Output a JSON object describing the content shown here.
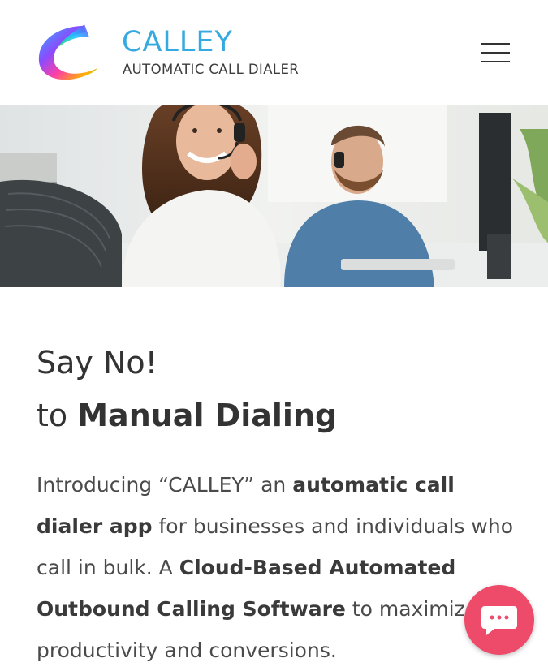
{
  "brand": {
    "name": "CALLEY",
    "tagline": "AUTOMATIC CALL DIALER"
  },
  "header": {
    "menu_icon": "hamburger-menu-icon"
  },
  "hero": {
    "image": "call-center-agents-with-headsets"
  },
  "headline": {
    "line1": "Say No!",
    "line2_prefix": "to ",
    "line2_bold": "Manual Dialing"
  },
  "intro": {
    "part1": "Introducing “CALLEY” an ",
    "bold1": "automatic call dialer app",
    "part2": " for businesses and individuals who call in bulk. A ",
    "bold2": "Cloud-Based Automated Outbound Calling Software",
    "part3": " to maximize productivity and conversions."
  },
  "chat": {
    "icon": "chat-bubble-icon"
  },
  "colors": {
    "brand_blue": "#36a9e1",
    "chat_pink": "#ee4b6a",
    "text_dark": "#333333"
  }
}
